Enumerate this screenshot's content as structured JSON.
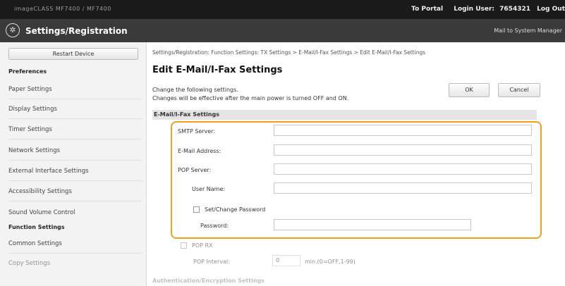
{
  "topbar": {
    "device_name": "imageCLASS   MF7400 / MF7400",
    "portal_link": "To Portal",
    "login_label": "Login User:",
    "login_user": "7654321",
    "logout_link": "Log Out"
  },
  "titlebar": {
    "title": "Settings/Registration",
    "mail_link": "Mail to System Manager"
  },
  "sidebar": {
    "restart_button": "Restart Device",
    "preferences_heading": "Preferences",
    "preferences_items": [
      "Paper Settings",
      "Display Settings",
      "Timer Settings",
      "Network Settings",
      "External Interface Settings",
      "Accessibility Settings",
      "Sound Volume Control"
    ],
    "function_heading": "Function Settings",
    "function_items": [
      "Common Settings",
      "Copy Settings"
    ]
  },
  "main": {
    "breadcrumb": "Settings/Registration: Function Settings: TX Settings > E-Mail/I-Fax Settings > Edit E-Mail/I-Fax Settings",
    "title": "Edit E-Mail/I-Fax Settings",
    "desc_line1": "Change the following settings.",
    "desc_line2": "Changes will be effective after the main power is turned OFF and ON.",
    "ok_button": "OK",
    "cancel_button": "Cancel",
    "section_title": "E-Mail/I-Fax Settings",
    "fields": {
      "smtp_server": {
        "label": "SMTP Server:",
        "value": ""
      },
      "email_address": {
        "label": "E-Mail Address:",
        "value": ""
      },
      "pop_server": {
        "label": "POP Server:",
        "value": ""
      },
      "user_name": {
        "label": "User Name:",
        "value": ""
      },
      "set_change_password": {
        "label": "Set/Change Password",
        "checked": false
      },
      "password": {
        "label": "Password:",
        "value": ""
      }
    },
    "pop_rx": {
      "label": "POP RX",
      "checked": false
    },
    "pop_interval": {
      "label": "POP Interval:",
      "value": "0",
      "unit": "min.(0=OFF,1-99)"
    },
    "auth_section_title": "Authentication/Encryption Settings"
  },
  "colors": {
    "highlight": "#f0a020",
    "topbar": "#1a1a1a",
    "titlebar": "#3a3a3a"
  }
}
